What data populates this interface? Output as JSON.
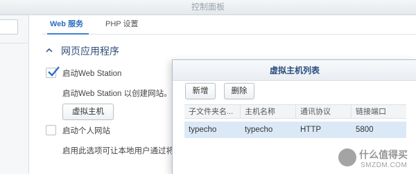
{
  "window": {
    "title": "控制面板"
  },
  "tabs": [
    {
      "label": "Web 服务",
      "active": true
    },
    {
      "label": "PHP 设置",
      "active": false
    }
  ],
  "section": {
    "title": "网页应用程序",
    "expanded": true
  },
  "options": {
    "web_station": {
      "label": "启动Web Station",
      "checked": true,
      "description": "启动Web Station 以创建网站。",
      "button_label": "虚拟主机"
    },
    "personal_site": {
      "label": "启动个人网站",
      "checked": false,
      "description": "启用此选项可让本地用户通过将"
    }
  },
  "dialog": {
    "title": "虚拟主机列表",
    "add_label": "新增",
    "delete_label": "删除",
    "columns": [
      "子文件夹名...",
      "主机名称",
      "通讯协议",
      "链接端口"
    ],
    "rows": [
      [
        "typecho",
        "typecho",
        "HTTP",
        "5800"
      ]
    ]
  },
  "watermark": {
    "icon": "smzdm-logo",
    "text": "什么值得买",
    "sub": "SMZDM.COM"
  },
  "colors": {
    "accent": "#3c83d3",
    "selected_row": "#dbe9f7",
    "section_title": "#2d4d7a"
  }
}
